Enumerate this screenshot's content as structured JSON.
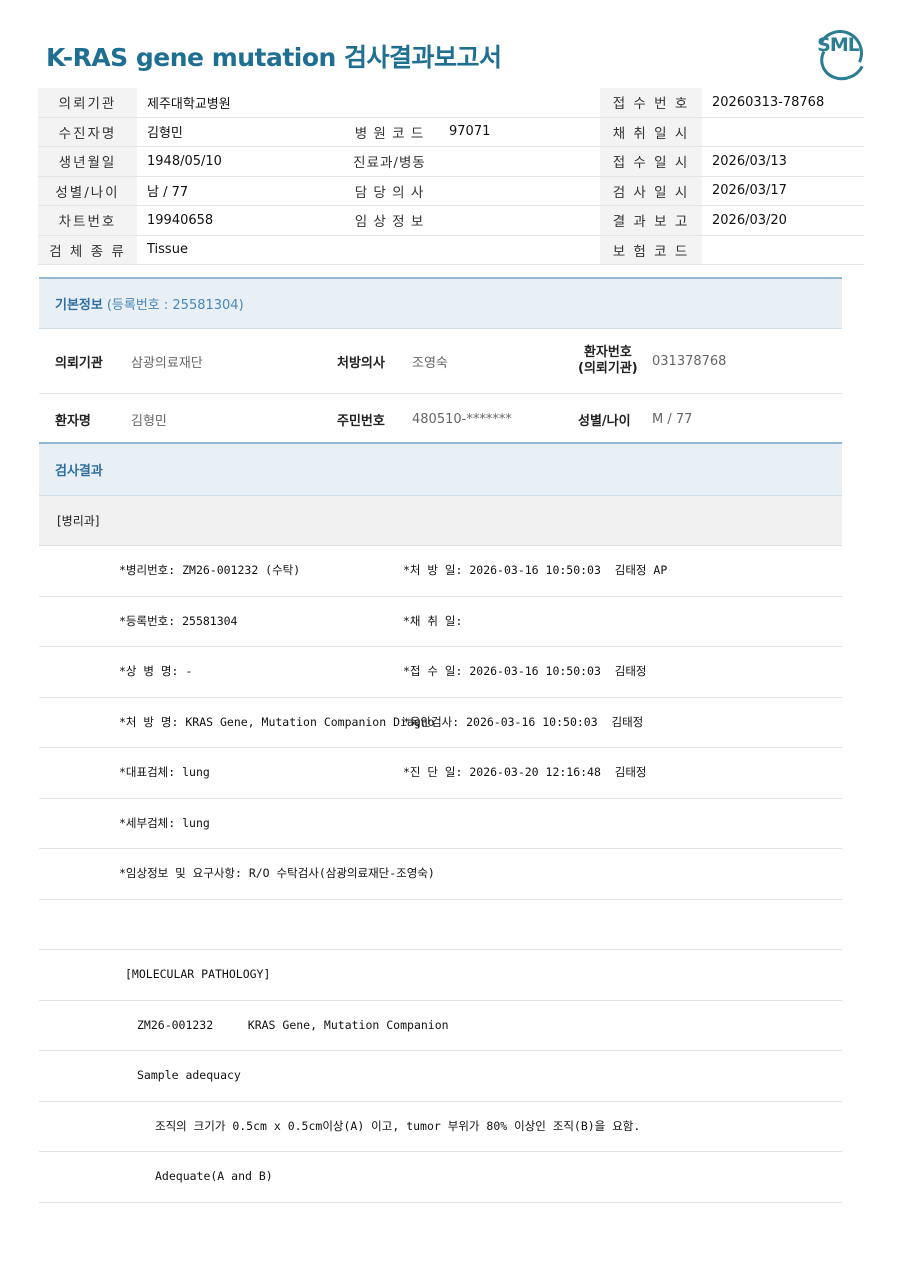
{
  "title": "K-RAS gene mutation 검사결과보고서",
  "logo_text": "SML",
  "header_rows": [
    [
      "의뢰기관",
      "제주대학교병원",
      "",
      "",
      "접 수 번 호",
      "20260313-78768"
    ],
    [
      "수진자명",
      "김형민",
      "병 원 코 드",
      "97071",
      "채 취 일 시",
      ""
    ],
    [
      "생년월일",
      "1948/05/10",
      "진료과/병동",
      "",
      "접 수 일 시",
      "2026/03/13"
    ],
    [
      "성별/나이",
      "남 / 77",
      "담 당 의 사",
      "",
      "검 사 일 시",
      "2026/03/17"
    ],
    [
      "차트번호",
      "19940658",
      "임 상 정 보",
      "",
      "결 과 보 고",
      "2026/03/20"
    ],
    [
      "검 체 종 류",
      "Tissue",
      "",
      "",
      "보 험 코 드",
      ""
    ]
  ],
  "basic_info": {
    "section_title": "기본정보",
    "section_sub": "(등록번호 : 25581304)",
    "row1": {
      "l1": "의뢰기관",
      "v1": "삼광의료재단",
      "l2": "처방의사",
      "v2": "조영숙",
      "l3a": "환자번호",
      "l3b": "(의뢰기관)",
      "v3": "031378768"
    },
    "row2": {
      "l1": "환자명",
      "v1": "김형민",
      "l2": "주민번호",
      "v2": "480510-*******",
      "l3": "성별/나이",
      "v3": "M / 77"
    }
  },
  "results": {
    "section_title": "검사결과",
    "dept": "[병리과]",
    "lines": [
      [
        "*병리번호: ZM26-001232 (수탁)",
        "*처 방 일: 2026-03-16 10:50:03  김태정 AP"
      ],
      [
        "*등록번호: 25581304",
        "*채 취 일:"
      ],
      [
        "*상 병 명: -",
        "*접 수 일: 2026-03-16 10:50:03  김태정"
      ],
      [
        "*처 방 명: KRAS Gene, Mutation Companion Diagno",
        "*육안검사: 2026-03-16 10:50:03  김태정"
      ],
      [
        "*대표검체: lung",
        "*진 단 일: 2026-03-20 12:16:48  김태정"
      ],
      [
        "*세부검체: lung",
        ""
      ],
      [
        "*임상정보 및 요구사항: R/O 수탁검사(삼광의료재단-조영숙)",
        ""
      ],
      [
        "",
        ""
      ]
    ],
    "molecular": [
      "[MOLECULAR PATHOLOGY]",
      "ZM26-001232     KRAS Gene, Mutation Companion",
      "Sample adequacy",
      "조직의 크기가 0.5cm x 0.5cm이상(A) 이고, tumor 부위가 80% 이상인 조직(B)을 요함.",
      "Adequate(A and B)"
    ]
  }
}
